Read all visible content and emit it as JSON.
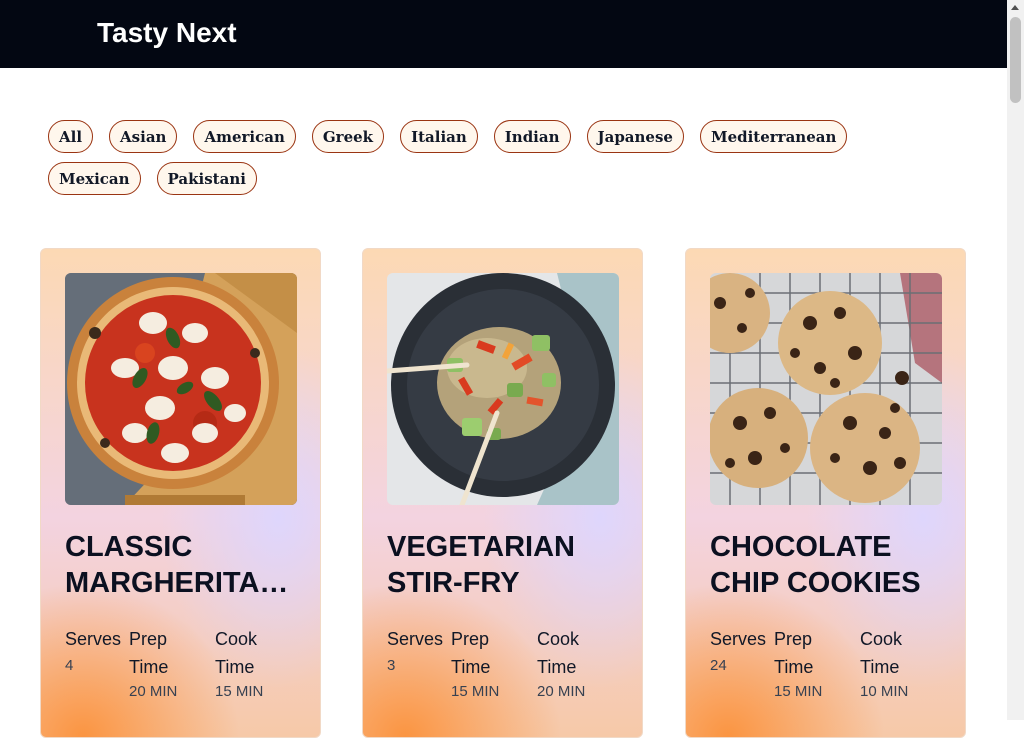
{
  "header": {
    "brand": "Tasty Next"
  },
  "filters": [
    "All",
    "Asian",
    "American",
    "Greek",
    "Italian",
    "Indian",
    "Japanese",
    "Mediterranean",
    "Mexican",
    "Pakistani"
  ],
  "labels": {
    "serves": "Serves",
    "prep": "Prep Time",
    "cook": "Cook Time"
  },
  "recipes": [
    {
      "title": "Classic Margherita…",
      "image": "pizza",
      "serves": "4",
      "prep": "20 MIN",
      "cook": "15 MIN"
    },
    {
      "title": "Vegetarian Stir-Fry",
      "image": "stir-fry",
      "serves": "3",
      "prep": "15 MIN",
      "cook": "20 MIN"
    },
    {
      "title": "Chocolate Chip Cookies",
      "image": "cookies",
      "serves": "24",
      "prep": "15 MIN",
      "cook": "10 MIN"
    }
  ]
}
